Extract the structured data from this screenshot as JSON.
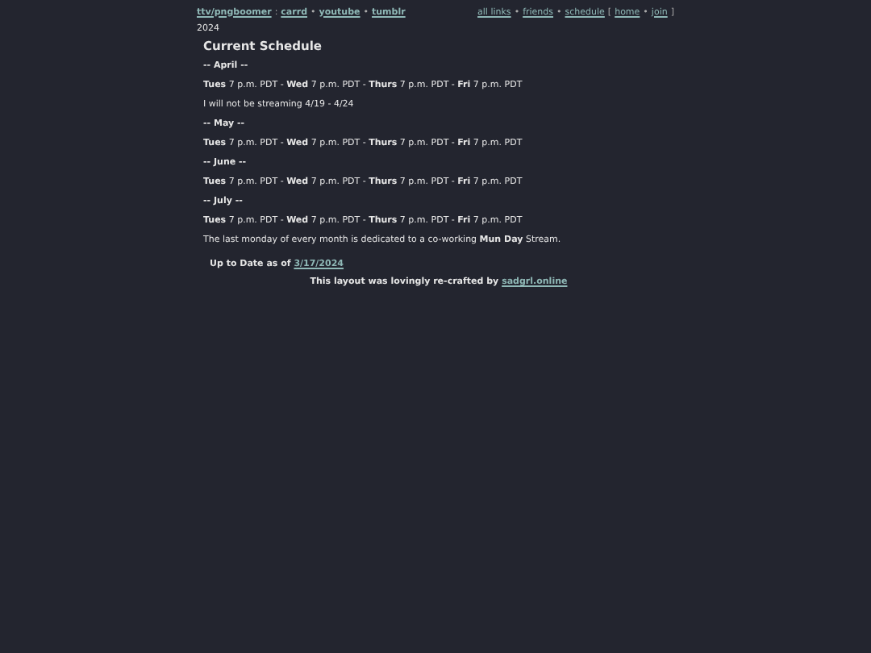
{
  "header": {
    "left": [
      {
        "kind": "link",
        "text": "ttv/pngboomer"
      },
      {
        "kind": "plain",
        "text": ":"
      },
      {
        "kind": "link",
        "text": "carrd"
      },
      {
        "kind": "plain",
        "text": "•"
      },
      {
        "kind": "link",
        "text": "youtube"
      },
      {
        "kind": "plain",
        "text": "•"
      },
      {
        "kind": "link",
        "text": "tumblr"
      }
    ],
    "right": [
      {
        "kind": "link",
        "text": "all links"
      },
      {
        "kind": "plain",
        "text": "•"
      },
      {
        "kind": "link",
        "text": "friends"
      },
      {
        "kind": "plain",
        "text": "•"
      },
      {
        "kind": "link",
        "text": "schedule"
      },
      {
        "kind": "plain",
        "text": "["
      },
      {
        "kind": "link",
        "text": "home"
      },
      {
        "kind": "plain",
        "text": "•"
      },
      {
        "kind": "link",
        "text": "join"
      },
      {
        "kind": "plain",
        "text": "]"
      }
    ],
    "year": "2024"
  },
  "title": "Current Schedule",
  "sections": [
    {
      "heading": "-- April --",
      "lines": [
        "**Tues** 7 p.m. PDT - **Wed** 7 p.m. PDT - **Thurs** 7 p.m. PDT - **Fri** 7 p.m. PDT",
        "I will not be streaming 4/19 - 4/24"
      ]
    },
    {
      "heading": "-- May --",
      "lines": [
        "**Tues** 7 p.m. PDT - **Wed** 7 p.m. PDT - **Thurs** 7 p.m. PDT - **Fri** 7 p.m. PDT"
      ]
    },
    {
      "heading": "-- June --",
      "lines": [
        "**Tues** 7 p.m. PDT - **Wed** 7 p.m. PDT - **Thurs** 7 p.m. PDT - **Fri** 7 p.m. PDT"
      ]
    },
    {
      "heading": "-- July --",
      "lines": [
        "**Tues** 7 p.m. PDT - **Wed** 7 p.m. PDT - **Thurs** 7 p.m. PDT - **Fri** 7 p.m. PDT",
        "The last monday of every month is dedicated to a co-working **Mun Day** Stream."
      ]
    }
  ],
  "updated": {
    "text": "Up to Date as of",
    "link": "3/17/2024"
  },
  "credit": {
    "text": "This layout was lovingly re-crafted by",
    "link": "sadgrl.online"
  }
}
